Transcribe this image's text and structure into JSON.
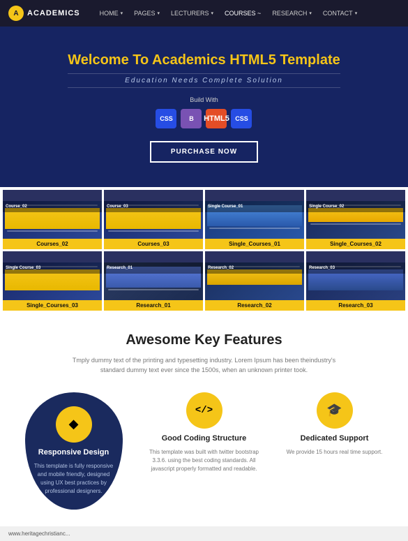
{
  "brand": {
    "icon": "A",
    "name": "ACADEMICS"
  },
  "nav": {
    "items": [
      {
        "label": "HOME",
        "arrow": "▾",
        "active": false
      },
      {
        "label": "PAGES",
        "arrow": "▾",
        "active": false
      },
      {
        "label": "LECTURERS",
        "arrow": "▾",
        "active": false
      },
      {
        "label": "COURSES ~",
        "arrow": "",
        "active": true
      },
      {
        "label": "RESEARCH",
        "arrow": "▾",
        "active": false
      },
      {
        "label": "CONTACT",
        "arrow": "▾",
        "active": false
      }
    ]
  },
  "hero": {
    "title_plain": "Welcome To Academics ",
    "title_highlight": "HTML5",
    "title_end": " Template",
    "subtitle": "Education Needs Complete Solution",
    "build_label": "Build With",
    "tech_icons": [
      {
        "label": "CSS",
        "class": "css"
      },
      {
        "label": "B",
        "class": "bootstrap"
      },
      {
        "label": "5",
        "class": "html"
      },
      {
        "label": "CSS",
        "class": "css3"
      }
    ],
    "purchase_btn": "PURCHASE NOW"
  },
  "grid": {
    "rows": [
      [
        {
          "label": "Courses_02",
          "bar": "Course_02"
        },
        {
          "label": "Courses_03",
          "bar": "Course_03"
        },
        {
          "label": "Single_Courses_01",
          "bar": "Single Course_01"
        },
        {
          "label": "Single_Courses_02",
          "bar": "Single Course_02"
        }
      ],
      [
        {
          "label": "Single_Courses_03",
          "bar": "Single Course_03"
        },
        {
          "label": "Research_01",
          "bar": "Research_01"
        },
        {
          "label": "Research_02",
          "bar": "Research_02"
        },
        {
          "label": "Research_03",
          "bar": "Research_03"
        }
      ]
    ]
  },
  "features": {
    "title": "Awesome Key Features",
    "description": "Tmply dummy text of the printing and typesetting industry. Lorem Ipsum has been theindustry's standard dummy text ever since the 1500s, when an unknown printer took.",
    "items": [
      {
        "icon": "◆",
        "title": "Responsive Design",
        "desc": "This template is fully responsive and mobile friendly, designed using UX best practices by professional designers.",
        "highlighted": true
      },
      {
        "icon": "</>",
        "title": "Good Coding Structure",
        "desc": "This template was built with twitter bootstrap 3.3.6. using the best coding standards. All javascript properly formatted and readable."
      },
      {
        "icon": "🎓",
        "title": "Dedicated Support",
        "desc": "We provide 15 hours real time support."
      }
    ]
  },
  "footer": {
    "url": "www.heritagechristianc..."
  }
}
